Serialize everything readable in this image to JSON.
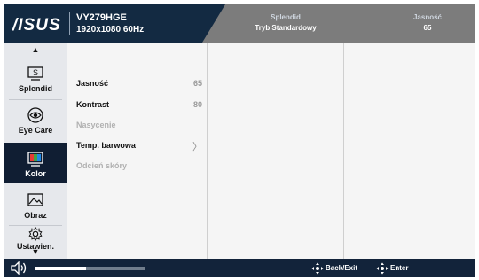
{
  "header": {
    "logo_text": "/ISUS",
    "model": "VY279HGE",
    "resolution": "1920x1080 60Hz",
    "splendid_label": "Splendid",
    "splendid_value": "Tryb Standardowy",
    "brightness_label": "Jasność",
    "brightness_value": "65"
  },
  "sidebar": {
    "up_arrow": "▲",
    "down_arrow": "▼",
    "items": [
      {
        "label": "Splendid",
        "icon": "splendid-icon",
        "active": false
      },
      {
        "label": "Eye Care",
        "icon": "eye-icon",
        "active": false
      },
      {
        "label": "Kolor",
        "icon": "color-bars-icon",
        "active": true
      },
      {
        "label": "Obraz",
        "icon": "image-icon",
        "active": false
      },
      {
        "label": "Ustawien.",
        "icon": "gear-icon",
        "active": false
      }
    ]
  },
  "menu": {
    "items": [
      {
        "label": "Jasność",
        "value": "65",
        "enabled": true
      },
      {
        "label": "Kontrast",
        "value": "80",
        "enabled": true
      },
      {
        "label": "Nasycenie",
        "value": "",
        "enabled": false
      },
      {
        "label": "Temp. barwowa",
        "value": "",
        "enabled": true,
        "submenu_glyph": "〉"
      },
      {
        "label": "Odcień skóry",
        "value": "",
        "enabled": false
      }
    ]
  },
  "footer": {
    "volume_level_fraction": 0.47,
    "back_label": "Back/Exit",
    "enter_label": "Enter"
  },
  "colors": {
    "header_dark": "#132a42",
    "header_gray": "#7c7c7c",
    "active_item": "#101e33",
    "footer": "#12233a"
  }
}
